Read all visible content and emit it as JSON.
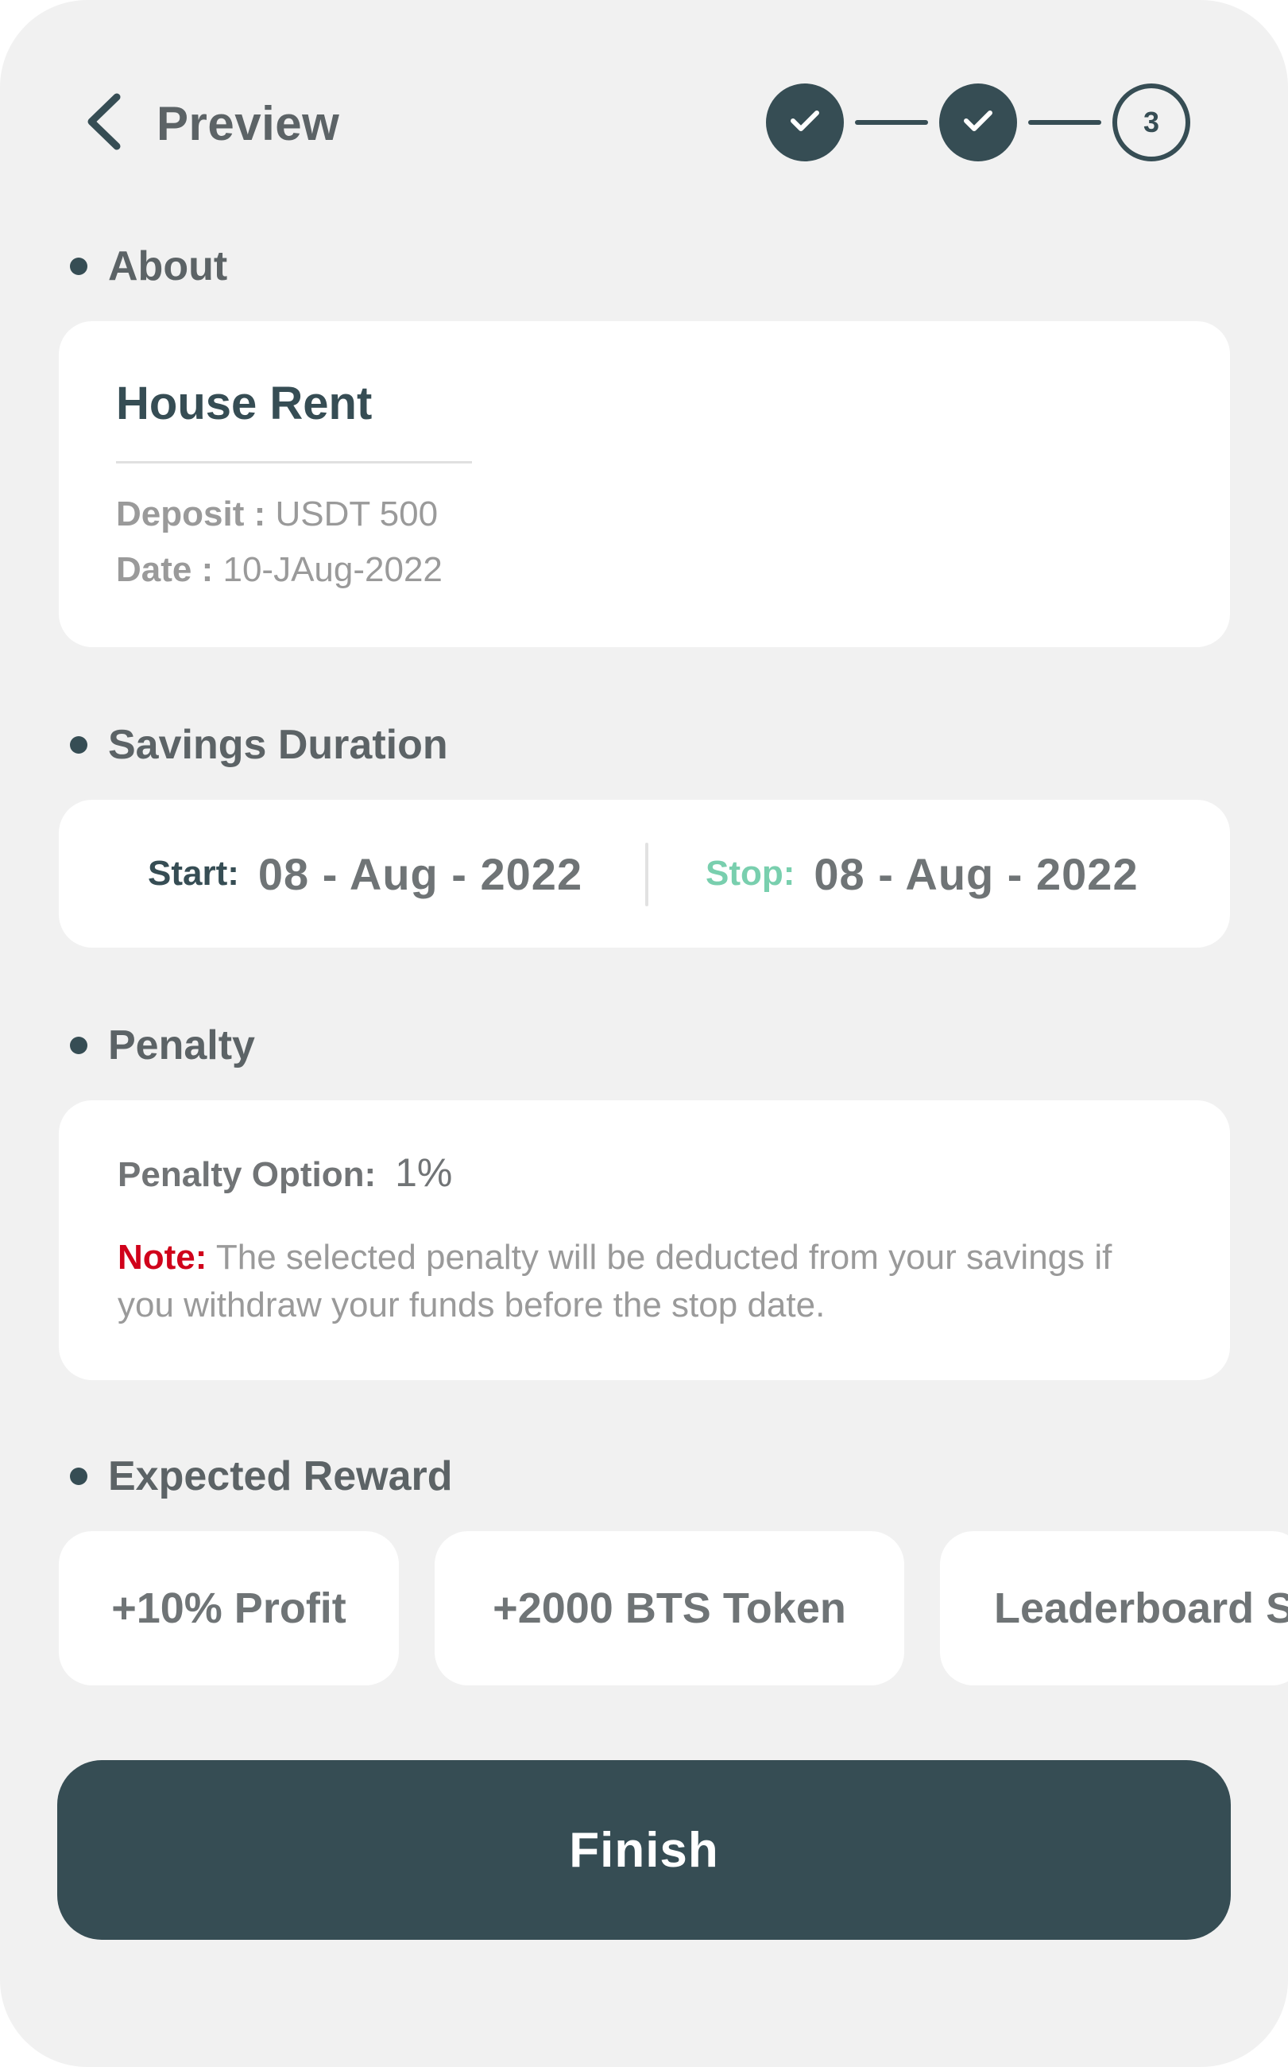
{
  "header": {
    "title": "Preview",
    "back_icon": "chevron-left-icon",
    "steps": [
      {
        "state": "done",
        "icon": "check-icon"
      },
      {
        "state": "done",
        "icon": "check-icon"
      },
      {
        "state": "current",
        "label": "3"
      }
    ]
  },
  "about": {
    "heading": "About",
    "title": "House Rent",
    "deposit_key": "Deposit :",
    "deposit_value": "USDT 500",
    "date_key": "Date :",
    "date_value": "10-JAug-2022"
  },
  "duration": {
    "heading": "Savings Duration",
    "start_label": "Start:",
    "start_value": "08 - Aug - 2022",
    "stop_label": "Stop:",
    "stop_value": "08 - Aug - 2022"
  },
  "penalty": {
    "heading": "Penalty",
    "option_label": "Penalty Option:",
    "option_value": "1%",
    "note_key": "Note:",
    "note_text": "The selected penalty will be deducted from your savings if you withdraw your funds before the stop date."
  },
  "rewards": {
    "heading": "Expected Reward",
    "items": [
      "+10% Profit",
      "+2000 BTS Token",
      "Leaderboard S"
    ]
  },
  "actions": {
    "finish_label": "Finish"
  },
  "colors": {
    "primary": "#364d54",
    "background": "#f1f1f1",
    "stop_accent": "#79cfae",
    "note_accent": "#d0021b"
  }
}
